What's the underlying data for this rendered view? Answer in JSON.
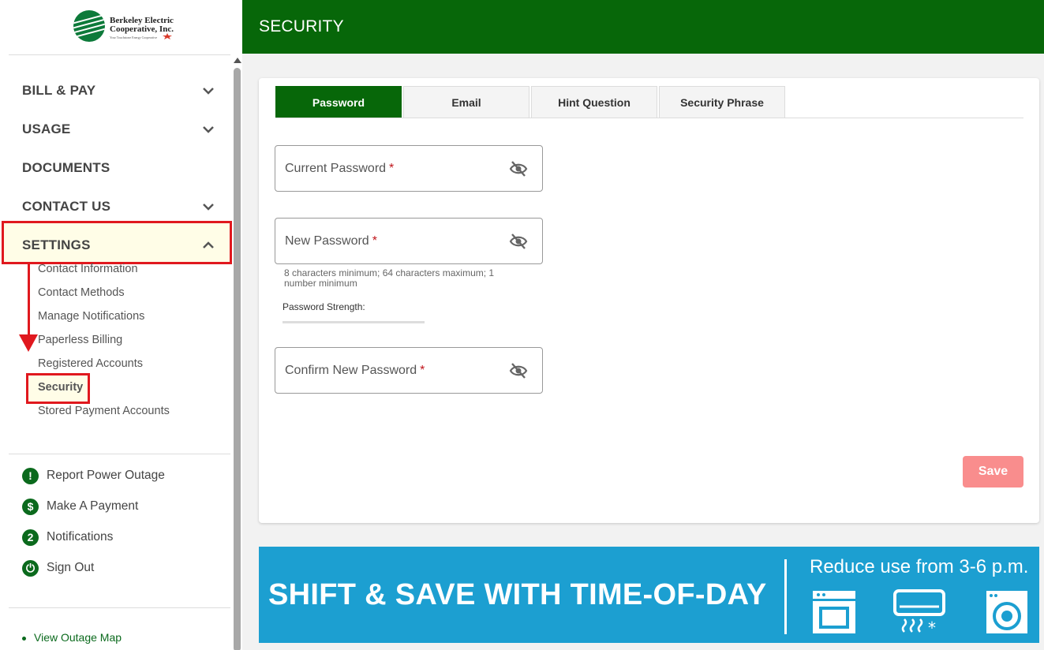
{
  "logo": {
    "name_line1": "Berkeley Electric",
    "name_line2": "Cooperative, Inc.",
    "tagline": "Your Touchstone Energy Cooperative"
  },
  "sidebar": {
    "nav": [
      {
        "label": "BILL & PAY",
        "expandable": true
      },
      {
        "label": "USAGE",
        "expandable": true
      },
      {
        "label": "DOCUMENTS",
        "expandable": false
      },
      {
        "label": "CONTACT US",
        "expandable": true
      },
      {
        "label": "SETTINGS",
        "expandable": true,
        "expanded": true
      }
    ],
    "settings_items": [
      "Contact Information",
      "Contact Methods",
      "Manage Notifications",
      "Paperless Billing",
      "Registered Accounts",
      "Security",
      "Stored Payment Accounts"
    ],
    "active_item": "Security",
    "quick_links": [
      {
        "icon": "exclamation-icon",
        "glyph": "!",
        "label": "Report Power Outage"
      },
      {
        "icon": "dollar-icon",
        "glyph": "$",
        "label": "Make A Payment"
      },
      {
        "icon": "notification-count-icon",
        "glyph": "2",
        "label": "Notifications"
      },
      {
        "icon": "power-icon",
        "glyph": "⏻",
        "label": "Sign Out"
      }
    ],
    "outage_map_label": "View Outage Map"
  },
  "header": {
    "title": "SECURITY"
  },
  "tabs": [
    {
      "label": "Password",
      "active": true
    },
    {
      "label": "Email",
      "active": false
    },
    {
      "label": "Hint Question",
      "active": false
    },
    {
      "label": "Security Phrase",
      "active": false
    }
  ],
  "form": {
    "current_password_label": "Current Password",
    "new_password_label": "New Password",
    "confirm_password_label": "Confirm New Password",
    "required_mark": "*",
    "password_hint": "8 characters minimum; 64 characters maximum; 1 number minimum",
    "strength_label": "Password Strength:",
    "save_label": "Save"
  },
  "banner": {
    "headline": "SHIFT & SAVE WITH TIME-OF-DAY",
    "subtext": "Reduce use from 3-6 p.m."
  },
  "colors": {
    "brand_green": "#076709",
    "highlight_red": "#e0181e",
    "save_button": "#f98d8d",
    "banner_blue": "#1c9fd1"
  }
}
